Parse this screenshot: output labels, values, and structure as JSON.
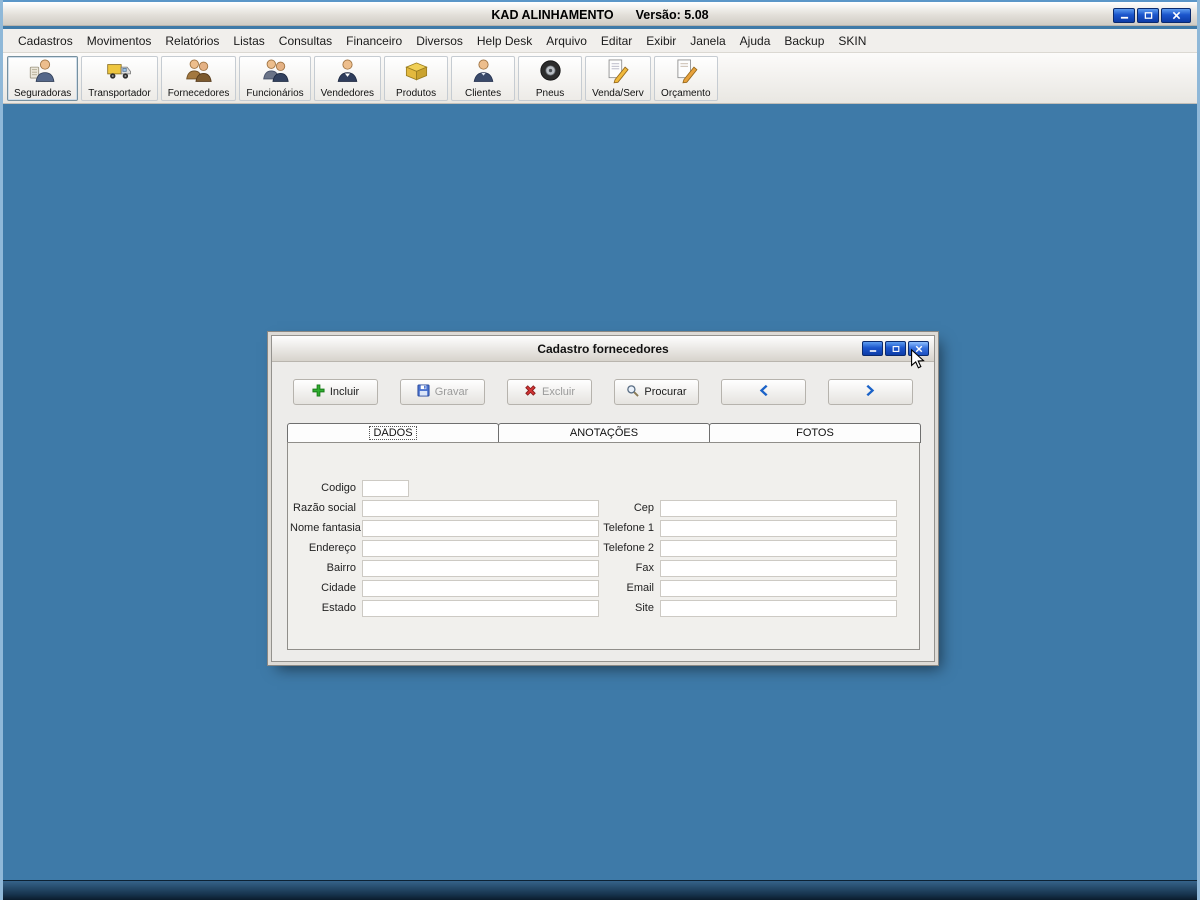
{
  "window": {
    "title": "KAD ALINHAMENTO",
    "version": "Versão: 5.08"
  },
  "menu": {
    "items": [
      "Cadastros",
      "Movimentos",
      "Relatórios",
      "Listas",
      "Consultas",
      "Financeiro",
      "Diversos",
      "Help Desk",
      "Arquivo",
      "Editar",
      "Exibir",
      "Janela",
      "Ajuda",
      "Backup",
      "SKIN"
    ]
  },
  "toolbar": {
    "items": [
      {
        "label": "Seguradoras",
        "icon": "insurance-person-icon"
      },
      {
        "label": "Transportador",
        "icon": "truck-icon"
      },
      {
        "label": "Fornecedores",
        "icon": "suppliers-people-icon"
      },
      {
        "label": "Funcionários",
        "icon": "employees-people-icon"
      },
      {
        "label": "Vendedores",
        "icon": "salesperson-icon"
      },
      {
        "label": "Produtos",
        "icon": "products-box-icon"
      },
      {
        "label": "Clientes",
        "icon": "client-person-icon"
      },
      {
        "label": "Pneus",
        "icon": "tire-icon"
      },
      {
        "label": "Venda/Serv",
        "icon": "sale-service-doc-icon"
      },
      {
        "label": "Orçamento",
        "icon": "budget-doc-icon"
      }
    ]
  },
  "dialog": {
    "title": "Cadastro fornecedores",
    "toolbar": {
      "incluir": "Incluir",
      "gravar": "Gravar",
      "excluir": "Excluir",
      "procurar": "Procurar"
    },
    "tabs": [
      "DADOS",
      "ANOTAÇÕES",
      "FOTOS"
    ],
    "form": {
      "left": [
        {
          "label": "Codigo",
          "value": ""
        },
        {
          "label": "Razão social",
          "value": ""
        },
        {
          "label": "Nome fantasia",
          "value": ""
        },
        {
          "label": "Endereço",
          "value": ""
        },
        {
          "label": "Bairro",
          "value": ""
        },
        {
          "label": "Cidade",
          "value": ""
        },
        {
          "label": "Estado",
          "value": ""
        }
      ],
      "right": [
        {
          "label": "Cep",
          "value": ""
        },
        {
          "label": "Telefone 1",
          "value": ""
        },
        {
          "label": "Telefone 2",
          "value": ""
        },
        {
          "label": "Fax",
          "value": ""
        },
        {
          "label": "Email",
          "value": ""
        },
        {
          "label": "Site",
          "value": ""
        }
      ]
    }
  },
  "colors": {
    "desktop": "#3e7aa8",
    "accent_blue": "#1b55cc"
  }
}
